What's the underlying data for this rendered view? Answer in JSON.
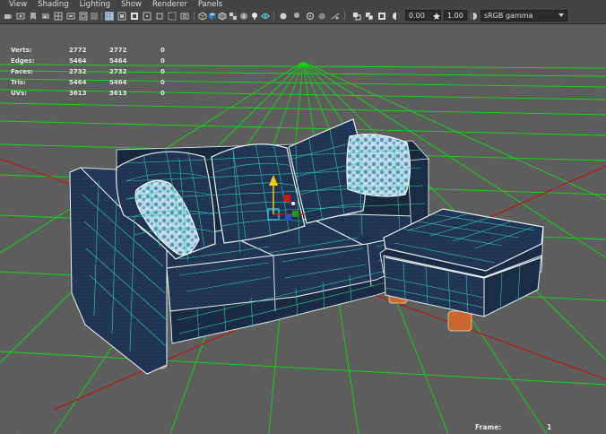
{
  "menu": [
    "View",
    "Shading",
    "Lighting",
    "Show",
    "Renderer",
    "Panels"
  ],
  "toolbar": {
    "icons": [
      "camera-icon",
      "wireframe-icon",
      "shaded-icon",
      "textured-icon",
      "lights-icon",
      "shadows-icon",
      "xray-icon",
      "isolate-icon",
      "grid-icon",
      "resolution-gate-icon",
      "field-chart-icon",
      "safe-area-icon",
      "film-gate-icon",
      "frame-all-icon",
      "cube-icon",
      "cube-wire-icon",
      "checker-icon",
      "light-bulb-icon",
      "sphere-icon",
      "sphere-shaded-icon",
      "ambient-occlusion-icon",
      "motion-blur-icon",
      "antialias-icon",
      "gamma-icon",
      "exposure-icon"
    ],
    "exposure_value": "0.00",
    "gamma_value": "1.00",
    "color_management": "sRGB gamma"
  },
  "hud": {
    "rows": [
      {
        "label": "Verts:",
        "object": "2772",
        "selected": "2772",
        "uv": "0"
      },
      {
        "label": "Edges:",
        "object": "5464",
        "selected": "5464",
        "uv": "0"
      },
      {
        "label": "Faces:",
        "object": "2732",
        "selected": "2732",
        "uv": "0"
      },
      {
        "label": "Tris:",
        "object": "5464",
        "selected": "5464",
        "uv": "0"
      },
      {
        "label": "UVs:",
        "object": "3613",
        "selected": "3613",
        "uv": "0"
      }
    ],
    "frame_label": "Frame:",
    "frame_value": "1"
  },
  "colors": {
    "grid": "#12d312",
    "axis": "#b81616",
    "fabric": "#1f3352",
    "fabric_dark": "#132036",
    "wire": "#2fc9a8",
    "pillow": "#a8cce0",
    "leg": "#c8682e"
  }
}
